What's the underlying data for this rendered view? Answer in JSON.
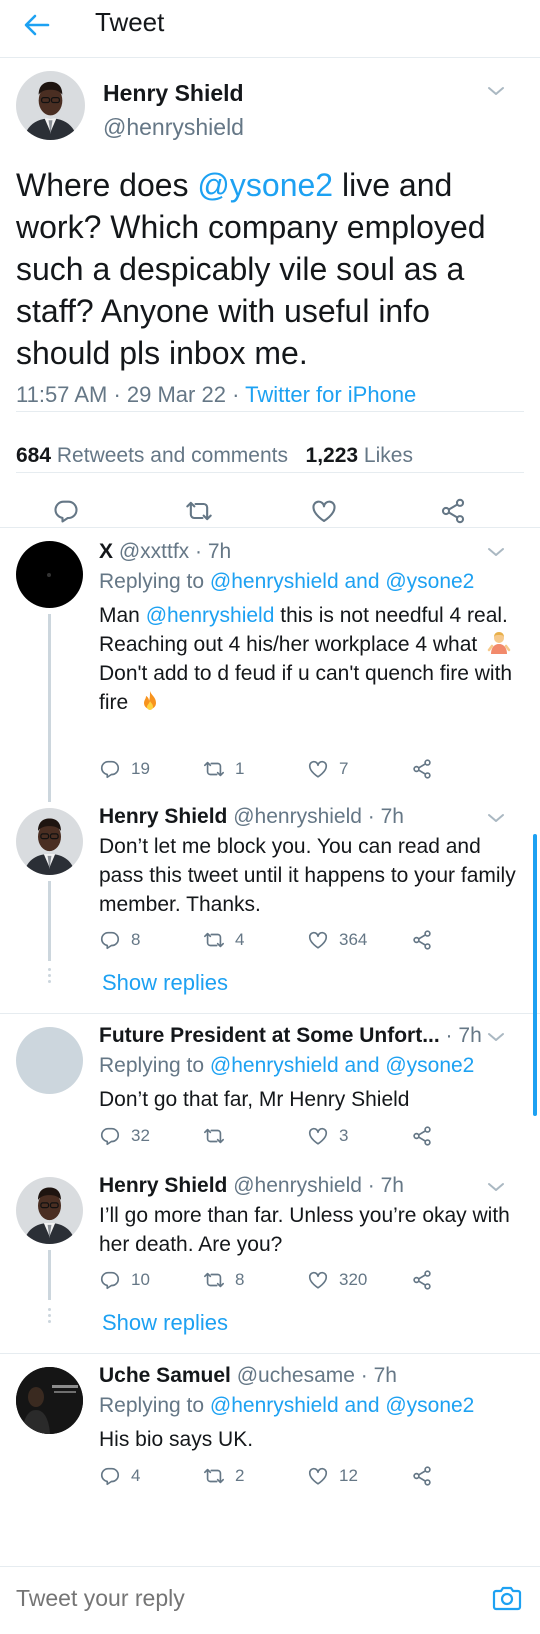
{
  "header": {
    "title": "Tweet"
  },
  "main_tweet": {
    "name": "Henry Shield",
    "handle": "@henryshield",
    "text_before": "Where does ",
    "mention": "@ysone2",
    "text_after": " live and work? Which company employed such a despicably vile soul as a staff? Anyone with useful info should pls inbox me.",
    "time": "11:57 AM",
    "date": "29 Mar 22",
    "source": "Twitter for iPhone",
    "retweets_count": "684",
    "retweets_label": "Retweets and comments",
    "likes_count": "1,223",
    "likes_label": "Likes"
  },
  "replies": [
    {
      "name": "X",
      "handle": "@xxttfx",
      "time": "7h",
      "replying_label": "Replying to",
      "replying_to": "@henryshield and @ysone2",
      "text_line1_prefix": "Man ",
      "text_line1_mention": "@henryshield",
      "text_line1_rest": " this is not needful 4 real. Reaching out 4 his/her workplace 4 what",
      "text_line2": "Don't add to d feud if u can't quench fire with fire",
      "replies": "19",
      "retweets": "1",
      "likes": "7"
    },
    {
      "name": "Henry Shield",
      "handle": "@henryshield",
      "time": "7h",
      "text": "Don’t let me block you. You can read and pass this tweet until it happens to your family member. Thanks.",
      "replies": "8",
      "retweets": "4",
      "likes": "364",
      "show_replies": "Show replies"
    },
    {
      "name": "Future President at Some Unfort...",
      "time": "7h",
      "replying_label": "Replying to",
      "replying_to": "@henryshield and @ysone2",
      "text": "Don’t go that far, Mr Henry Shield",
      "replies": "32",
      "retweets": "",
      "likes": "3"
    },
    {
      "name": "Henry Shield",
      "handle": "@henryshield",
      "time": "7h",
      "text": "I’ll go more than far. Unless you’re okay with her death. Are you?",
      "replies": "10",
      "retweets": "8",
      "likes": "320",
      "show_replies": "Show replies"
    },
    {
      "name": "Uche Samuel",
      "handle": "@uchesame",
      "time": "7h",
      "replying_label": "Replying to",
      "replying_to": "@henryshield and @ysone2",
      "text": "His bio says UK.",
      "replies": "4",
      "retweets": "2",
      "likes": "12"
    }
  ],
  "composer": {
    "placeholder": "Tweet your reply"
  },
  "colors": {
    "accent": "#1da1f2",
    "muted": "#657786",
    "text": "#14171a",
    "divider": "#e6ecf0"
  },
  "icons": [
    "back-arrow-icon",
    "chevron-down-icon",
    "reply-icon",
    "retweet-icon",
    "like-icon",
    "share-icon",
    "camera-icon",
    "person-gesturing-emoji",
    "fire-emoji"
  ]
}
